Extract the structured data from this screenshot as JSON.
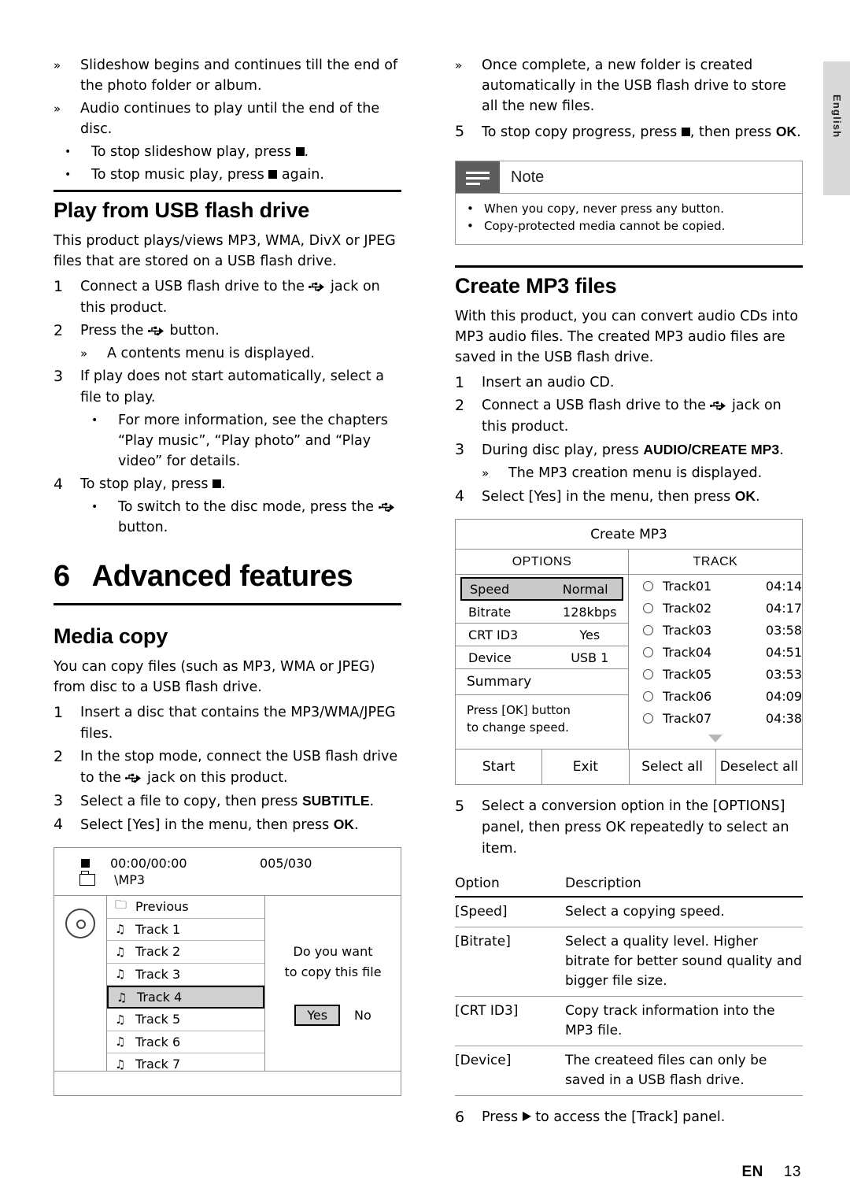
{
  "page": {
    "language_tab": "English",
    "footer_lang": "EN",
    "footer_page": "13"
  },
  "left_column": {
    "intro_bullets": [
      {
        "mark": "»",
        "text": "Slideshow begins and continues till the end of the photo folder or album."
      },
      {
        "mark": "»",
        "text": "Audio continues to play until the end of the disc."
      }
    ],
    "intro_dots": [
      {
        "text_before": "To stop slideshow play, press ",
        "icon": "stop-icon",
        "text_after": "."
      },
      {
        "text_before": "To stop music play, press ",
        "icon": "stop-icon",
        "text_after": " again."
      }
    ],
    "usb_section": {
      "title": "Play from USB flash drive",
      "intro": "This product plays/views MP3, WMA, DivX or JPEG files that are stored on a USB flash drive.",
      "steps": [
        {
          "num": "1",
          "parts": [
            {
              "t": "Connect a USB flash drive to the "
            },
            {
              "icon": "usb-icon"
            },
            {
              "t": " jack on this product."
            }
          ]
        },
        {
          "num": "2",
          "parts": [
            {
              "t": "Press the "
            },
            {
              "icon": "usb-icon"
            },
            {
              "t": " button."
            }
          ]
        }
      ],
      "step2_sub": "A contents menu is displayed.",
      "step3": {
        "num": "3",
        "text": "If play does not start automatically, select a file to play."
      },
      "step3_dot": "For more information, see the chapters “Play music”, “Play photo” and “Play video” for details.",
      "step4": {
        "num": "4",
        "text_before": "To stop play, press ",
        "icon": "stop-icon",
        "text_after": "."
      },
      "step4_dot": {
        "text_before": "To switch to the disc mode, press the ",
        "icon": "usb-icon",
        "text_after": " button."
      }
    },
    "chapter": {
      "num": "6",
      "title": "Advanced features"
    },
    "media_copy": {
      "title": "Media copy",
      "intro": "You can copy files (such as MP3, WMA or JPEG) from disc to a USB flash drive.",
      "steps": [
        {
          "num": "1",
          "text": "Insert a disc that contains the MP3/WMA/JPEG files."
        },
        {
          "num": "2",
          "text_before": "In the stop mode, connect the USB flash drive to the ",
          "icon": "usb-icon",
          "text_after": " jack on this product."
        },
        {
          "num": "3",
          "text_before": "Select a file to copy, then press ",
          "bold": "SUBTITLE",
          "text_after": "."
        },
        {
          "num": "4",
          "text_before": "Select [Yes] in the menu, then press ",
          "bold": "OK",
          "text_after": "."
        }
      ]
    },
    "copy_screen": {
      "time": "00:00/00:00",
      "count": "005/030",
      "path": "\\MP3",
      "items": [
        {
          "icon": "folder-icon",
          "label": "Previous",
          "selected": false
        },
        {
          "icon": "music-note-icon",
          "label": "Track 1",
          "selected": false
        },
        {
          "icon": "music-note-icon",
          "label": "Track 2",
          "selected": false
        },
        {
          "icon": "music-note-icon",
          "label": "Track 3",
          "selected": false
        },
        {
          "icon": "music-note-icon",
          "label": "Track 4",
          "selected": true
        },
        {
          "icon": "music-note-icon",
          "label": "Track 5",
          "selected": false
        },
        {
          "icon": "music-note-icon",
          "label": "Track 6",
          "selected": false
        },
        {
          "icon": "music-note-icon",
          "label": "Track 7",
          "selected": false
        }
      ],
      "prompt_line1": "Do you want",
      "prompt_line2": "to copy this file",
      "yes": "Yes",
      "no": "No"
    }
  },
  "right_column": {
    "top_bullet": "Once complete, a new folder is created automatically in the USB flash drive to store all the new files.",
    "step5": {
      "num": "5",
      "text_before": "To stop copy progress, press ",
      "icon": "stop-icon",
      "text_mid": ", then press ",
      "bold": "OK",
      "text_after": "."
    },
    "note": {
      "title": "Note",
      "items": [
        "When you copy, never press any button.",
        "Copy-protected media cannot be copied."
      ]
    },
    "mp3_section": {
      "title": "Create MP3 files",
      "intro": "With this product, you can convert audio CDs into MP3 audio files. The created MP3 audio files are saved in the USB flash drive.",
      "steps": [
        {
          "num": "1",
          "text": "Insert an audio CD."
        },
        {
          "num": "2",
          "text_before": "Connect a USB flash drive to the ",
          "icon": "usb-icon",
          "text_after": " jack on this product."
        },
        {
          "num": "3",
          "text_before": "During disc play, press ",
          "bold": "AUDIO/CREATE MP3",
          "text_after": "."
        },
        {
          "num": "4",
          "text_before": "Select [Yes] in the menu, then press ",
          "bold": "OK",
          "text_after": "."
        }
      ],
      "step3_sub": "The MP3 creation menu is displayed."
    },
    "mp3_screen": {
      "title": "Create MP3",
      "col_options": "OPTIONS",
      "col_track": "TRACK",
      "options": [
        {
          "key": "Speed",
          "value": "Normal",
          "selected": true
        },
        {
          "key": "Bitrate",
          "value": "128kbps",
          "selected": false
        },
        {
          "key": "CRT ID3",
          "value": "Yes",
          "selected": false
        },
        {
          "key": "Device",
          "value": "USB 1",
          "selected": false
        }
      ],
      "summary_label": "Summary",
      "summary_line1": "Press [OK] button",
      "summary_line2": "to change speed.",
      "tracks": [
        {
          "name": "Track01",
          "time": "04:14"
        },
        {
          "name": "Track02",
          "time": "04:17"
        },
        {
          "name": "Track03",
          "time": "03:58"
        },
        {
          "name": "Track04",
          "time": "04:51"
        },
        {
          "name": "Track05",
          "time": "03:53"
        },
        {
          "name": "Track06",
          "time": "04:09"
        },
        {
          "name": "Track07",
          "time": "04:38"
        }
      ],
      "buttons": [
        "Start",
        "Exit",
        "Select all",
        "Deselect all"
      ]
    },
    "step5_after": {
      "num": "5",
      "text": "Select a conversion option in the [OPTIONS] panel, then press OK repeatedly to select an item."
    },
    "options_table": {
      "header_option": "Option",
      "header_description": "Description",
      "rows": [
        {
          "option": "[Speed]",
          "description": "Select a copying speed."
        },
        {
          "option": "[Bitrate]",
          "description": "Select a quality level. Higher bitrate for better sound quality and bigger file size."
        },
        {
          "option": "[CRT ID3]",
          "description": "Copy track information into the MP3 file."
        },
        {
          "option": "[Device]",
          "description": "The createed files can only be saved in a USB flash drive."
        }
      ]
    },
    "step6": {
      "num": "6",
      "text_before": "Press ",
      "icon": "play-right-icon",
      "text_after": " to access the [Track] panel."
    }
  }
}
